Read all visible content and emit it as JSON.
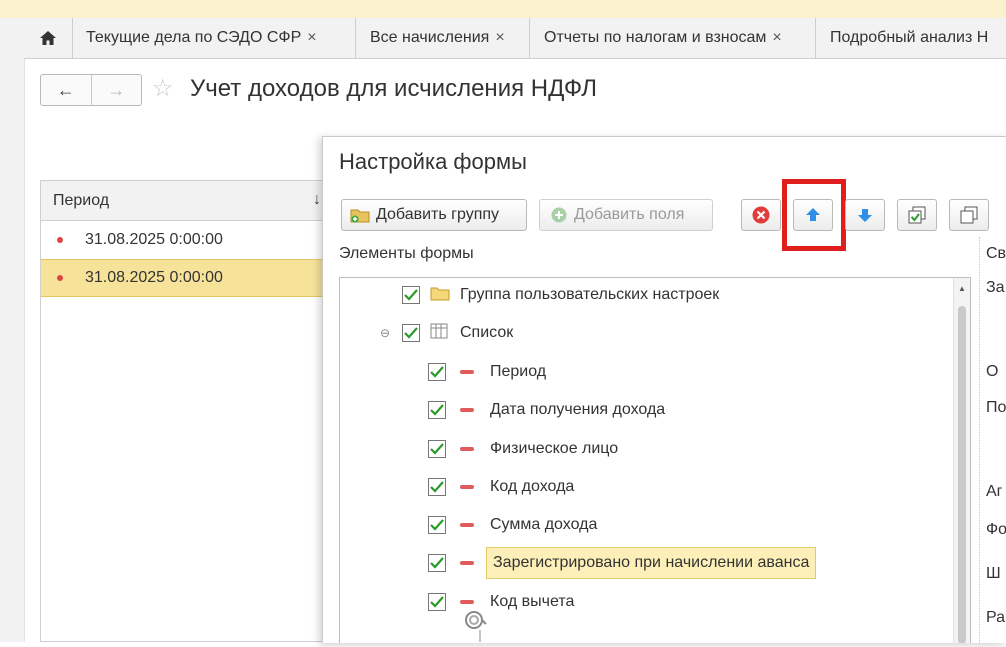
{
  "tabs": [
    {
      "label": "Текущие дела по СЭДО СФР",
      "close": "×"
    },
    {
      "label": "Все начисления",
      "close": "×"
    },
    {
      "label": "Отчеты по налогам и взносам",
      "close": "×"
    },
    {
      "label": "Подробный анализ Н",
      "close": ""
    }
  ],
  "header": {
    "back": "←",
    "forward": "→",
    "star": "☆",
    "title": "Учет доходов для исчисления НДФЛ"
  },
  "list": {
    "column": "Период",
    "sort_icon": "↓",
    "rows": [
      {
        "value": "31.08.2025 0:00:00"
      },
      {
        "value": "31.08.2025 0:00:00"
      }
    ]
  },
  "dialog": {
    "title": "Настройка формы",
    "add_group": "Добавить группу",
    "add_fields": "Добавить поля",
    "section_label": "Элементы формы",
    "tree": [
      {
        "label": "Группа пользовательских настроек"
      },
      {
        "label": "Список"
      },
      {
        "label": "Период"
      },
      {
        "label": "Дата получения дохода"
      },
      {
        "label": "Физическое лицо"
      },
      {
        "label": "Код дохода"
      },
      {
        "label": "Сумма дохода"
      },
      {
        "label": "Зарегистрировано при начислении аванса"
      },
      {
        "label": "Код вычета"
      }
    ],
    "right_letters": [
      "Св",
      "За",
      "О",
      "По",
      "Аг",
      "Фо",
      "Ш",
      "Ра"
    ]
  },
  "colors": {
    "accent_selected": "#f7e29a",
    "red_frame": "#e01e1e",
    "arrow_blue": "#2f8fe6",
    "check_green": "#2a9b2a"
  }
}
